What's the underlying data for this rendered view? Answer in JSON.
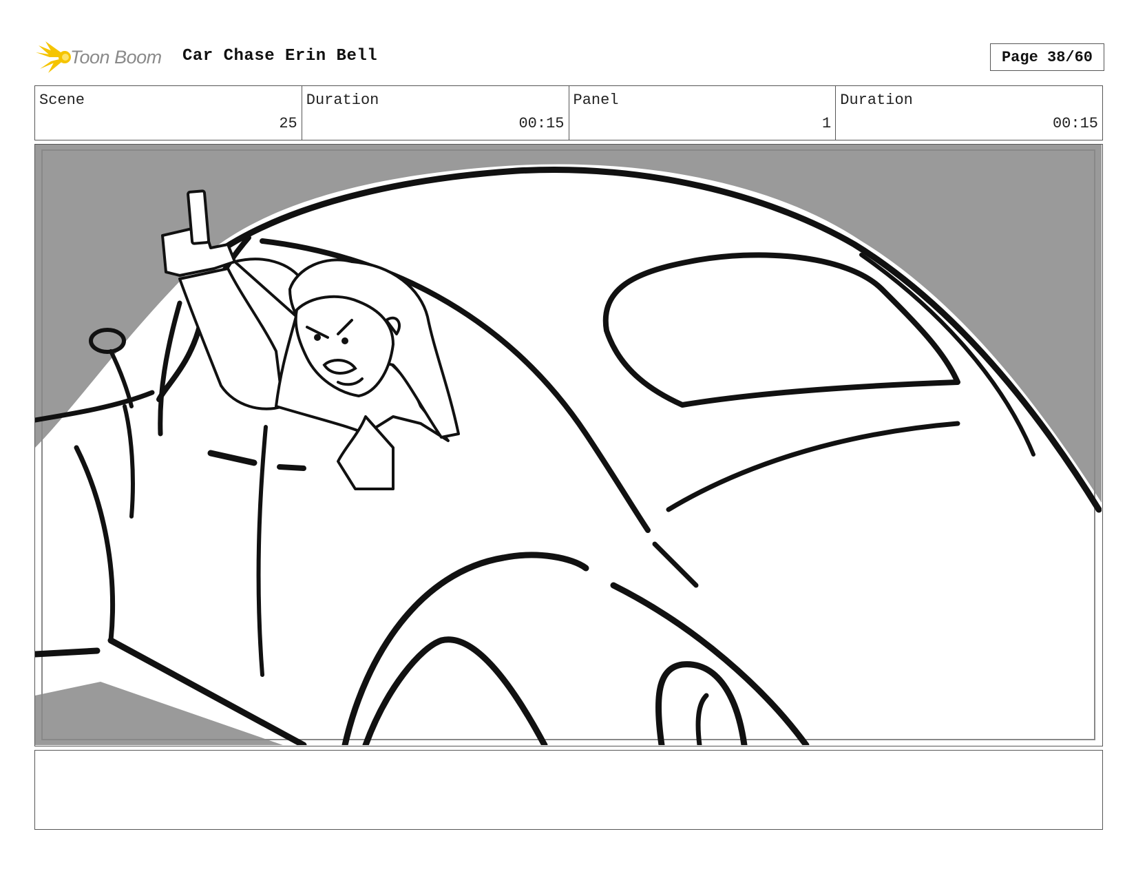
{
  "header": {
    "logo_text": "Toon Boom",
    "title": "Car Chase Erin Bell",
    "page_label": "Page 38/60"
  },
  "info": {
    "scene_label": "Scene",
    "scene_value": "25",
    "scene_duration_label": "Duration",
    "scene_duration_value": "00:15",
    "panel_label": "Panel",
    "panel_value": "1",
    "panel_duration_label": "Duration",
    "panel_duration_value": "00:15"
  },
  "notes": {
    "text": ""
  },
  "colors": {
    "sky_gray": "#9a9a9a",
    "ink": "#111111",
    "logo_yellow": "#f5c400"
  }
}
